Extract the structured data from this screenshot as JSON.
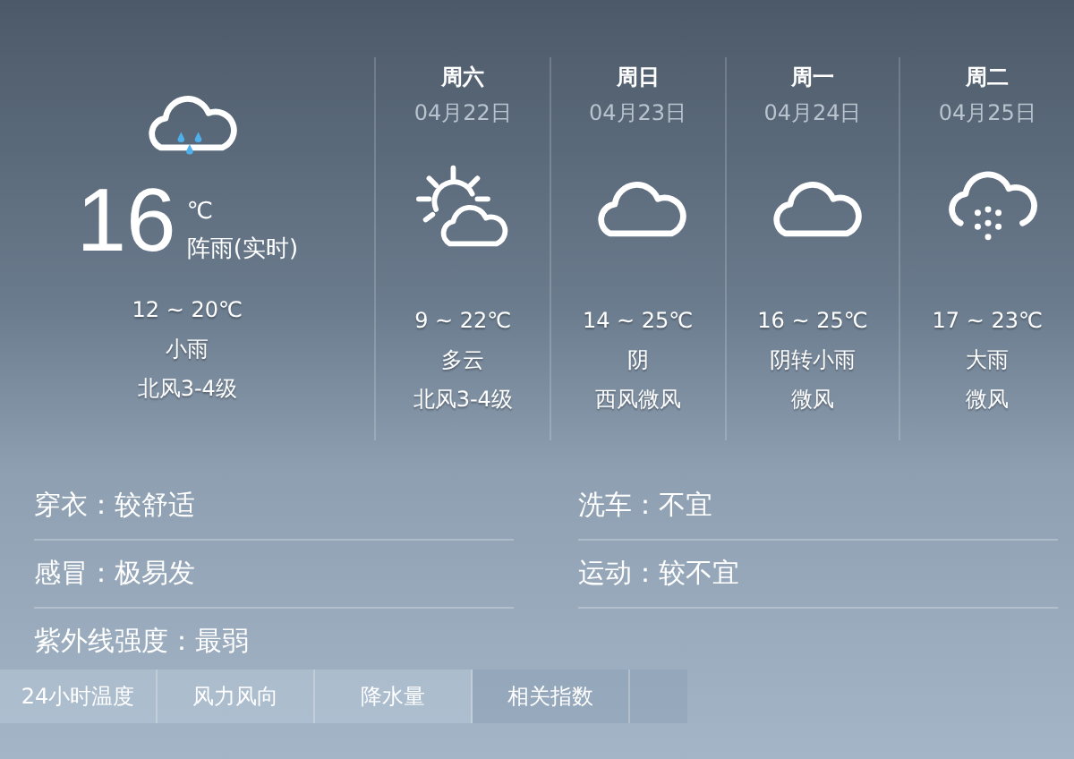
{
  "current": {
    "kind": "light_rain",
    "temp": "16",
    "unit": "℃",
    "desc": "阵雨(实时)",
    "range": "12 ~ 20℃",
    "weather": "小雨",
    "wind": "北风3-4级"
  },
  "forecast": [
    {
      "weekday": "周六",
      "date": "04月22日",
      "kind": "partly_cloudy",
      "range": "9 ~ 22℃",
      "weather": "多云",
      "wind": "北风3-4级"
    },
    {
      "weekday": "周日",
      "date": "04月23日",
      "kind": "cloudy",
      "range": "14 ~ 25℃",
      "weather": "阴",
      "wind": "西风微风"
    },
    {
      "weekday": "周一",
      "date": "04月24日",
      "kind": "cloudy",
      "range": "16 ~ 25℃",
      "weather": "阴转小雨",
      "wind": "微风"
    },
    {
      "weekday": "周二",
      "date": "04月25日",
      "kind": "heavy_rain",
      "range": "17 ~ 23℃",
      "weather": "大雨",
      "wind": "微风"
    }
  ],
  "indices": [
    {
      "text": "穿衣：较舒适"
    },
    {
      "text": "洗车：不宜"
    },
    {
      "text": "感冒：极易发"
    },
    {
      "text": "运动：较不宜"
    },
    {
      "text": "紫外线强度：最弱"
    }
  ],
  "tabs": [
    {
      "label": "24小时温度",
      "selected": false
    },
    {
      "label": "风力风向",
      "selected": false
    },
    {
      "label": "降水量",
      "selected": false
    },
    {
      "label": "相关指数",
      "selected": true
    }
  ]
}
